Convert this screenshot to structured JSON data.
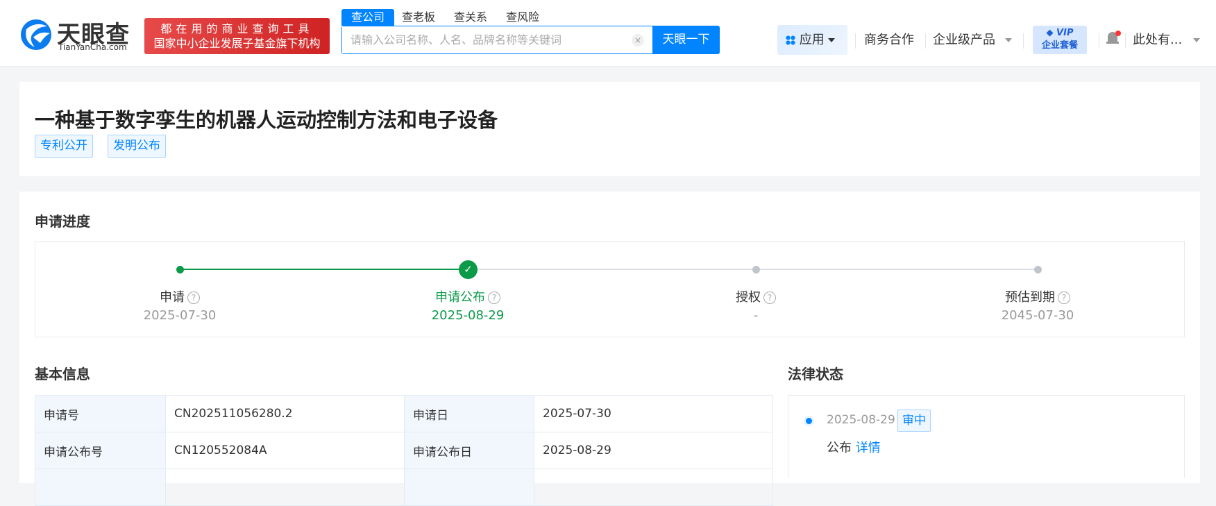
{
  "header": {
    "logo": {
      "name": "天眼查",
      "domain": "TianYanCha.com"
    },
    "badge": {
      "line1": "都在用的商业查询工具",
      "line2": "国家中小企业发展子基金旗下机构"
    },
    "search_tabs": [
      "查公司",
      "查老板",
      "查关系",
      "查风险"
    ],
    "search": {
      "placeholder": "请输入公司名称、人名、品牌名称等关键词",
      "clear": "×",
      "button": "天眼一下"
    },
    "nav": {
      "apps": "应用",
      "business": "商务合作",
      "enterprise": "企业级产品",
      "vip_top": "VIP",
      "vip_bottom": "企业套餐",
      "user": "此处有..."
    }
  },
  "title_card": {
    "title": "一种基于数字孪生的机器人运动控制方法和电子设备",
    "tags": [
      "专利公开",
      "发明公布"
    ]
  },
  "progress": {
    "heading": "申请进度",
    "steps": [
      {
        "label": "申请",
        "date": "2025-07-30",
        "state": "done"
      },
      {
        "label": "申请公布",
        "date": "2025-08-29",
        "state": "current"
      },
      {
        "label": "授权",
        "date": "-",
        "state": "pending"
      },
      {
        "label": "预估到期",
        "date": "2045-07-30",
        "state": "pending"
      }
    ],
    "colors": {
      "done": "#0a9a48",
      "pending": "#c0c4cc"
    }
  },
  "basic_info": {
    "heading": "基本信息",
    "rows": [
      [
        "申请号",
        "CN202511056280.2",
        "申请日",
        "2025-07-30"
      ],
      [
        "申请公布号",
        "CN120552084A",
        "申请公布日",
        "2025-08-29"
      ]
    ]
  },
  "legal_status": {
    "heading": "法律状态",
    "items": [
      {
        "date": "2025-08-29",
        "badge": "审中",
        "event": "公布",
        "link": "详情"
      }
    ]
  }
}
